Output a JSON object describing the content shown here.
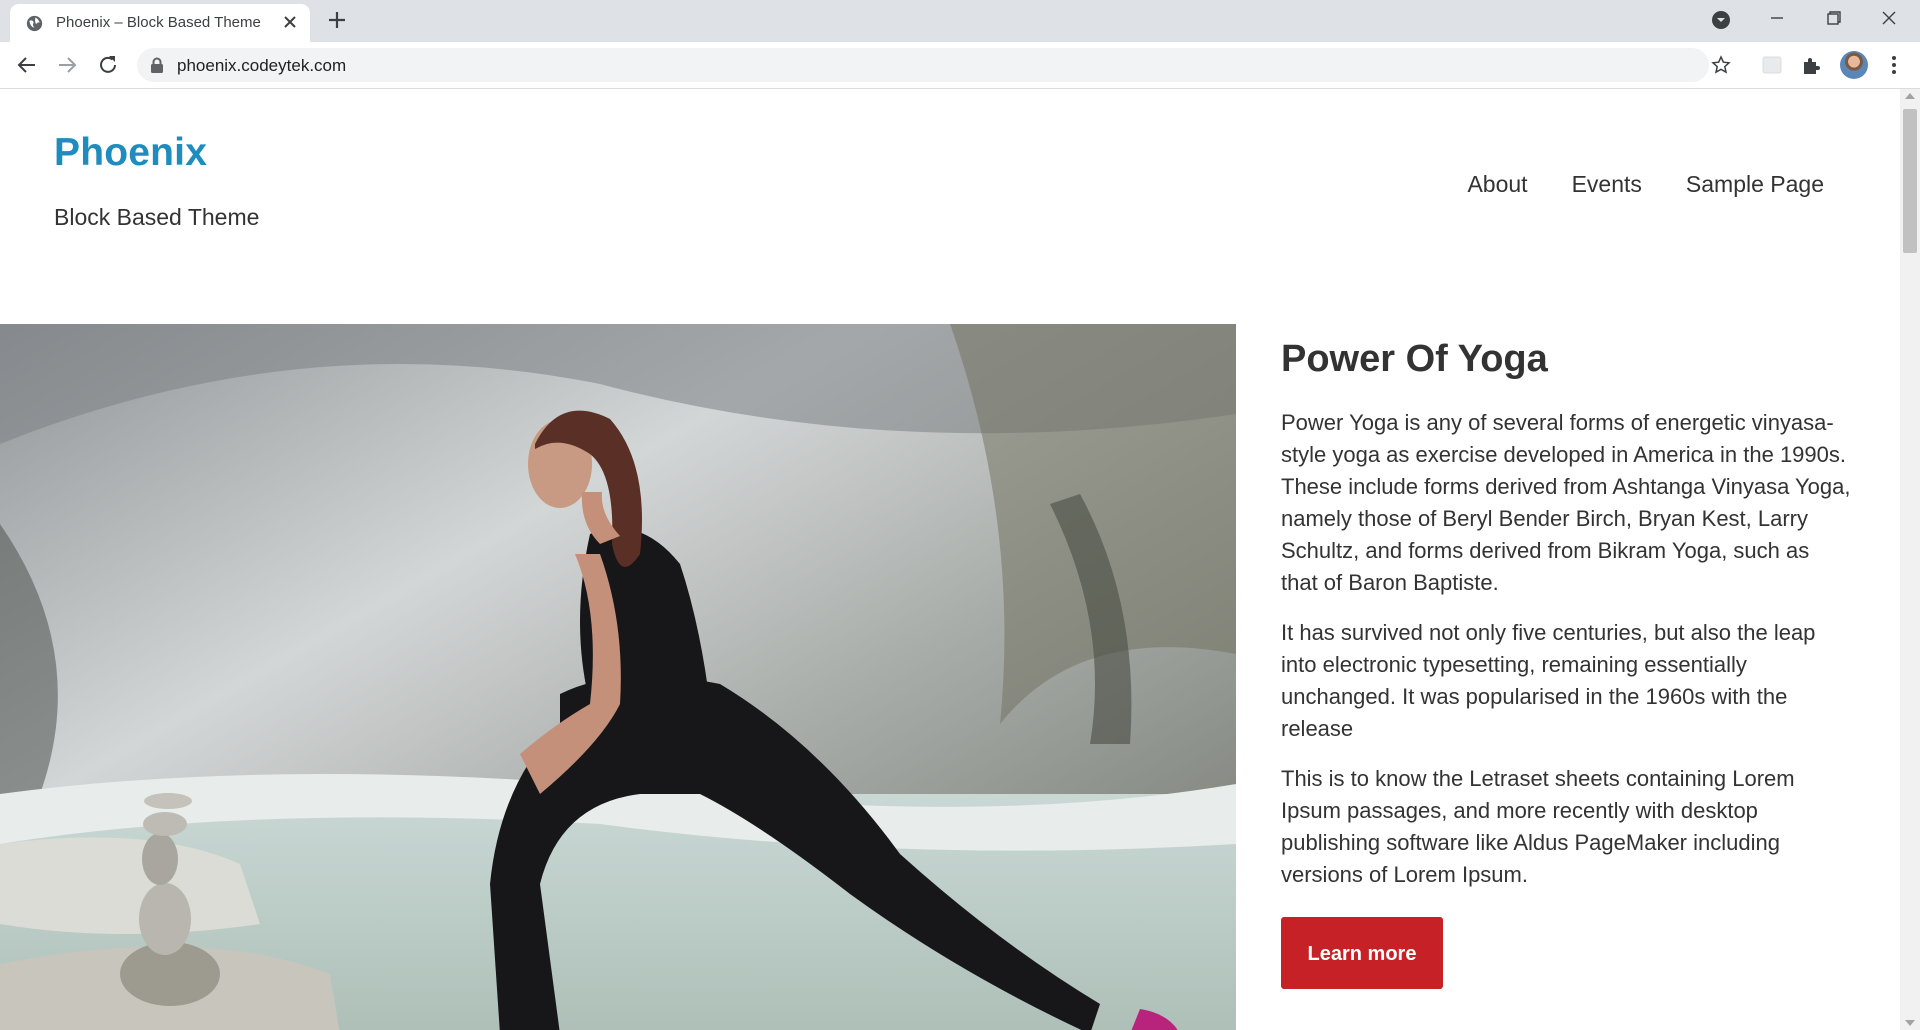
{
  "browser": {
    "tab_title": "Phoenix – Block Based Theme",
    "url": "phoenix.codeytek.com"
  },
  "site": {
    "title": "Phoenix",
    "tagline": "Block Based Theme",
    "title_color": "#1e8cbe"
  },
  "nav": {
    "items": [
      "About",
      "Events",
      "Sample Page"
    ]
  },
  "hero": {
    "heading": "Power Of Yoga",
    "paragraphs": [
      "Power Yoga is any of several forms of energetic vinyasa-style yoga as exercise developed in America in the 1990s. These include forms derived from Ashtanga Vinyasa Yoga, namely those of Beryl Bender Birch, Bryan Kest, Larry Schultz, and forms derived from Bikram Yoga, such as that of Baron Baptiste.",
      "It has survived not only five centuries, but also the leap into electronic typesetting, remaining essentially unchanged. It was popularised in the 1960s with the release",
      "This is to know the Letraset sheets containing Lorem Ipsum passages, and more recently with desktop publishing software like Aldus PageMaker including versions of Lorem Ipsum."
    ],
    "button_label": "Learn more",
    "button_color": "#c62127"
  }
}
